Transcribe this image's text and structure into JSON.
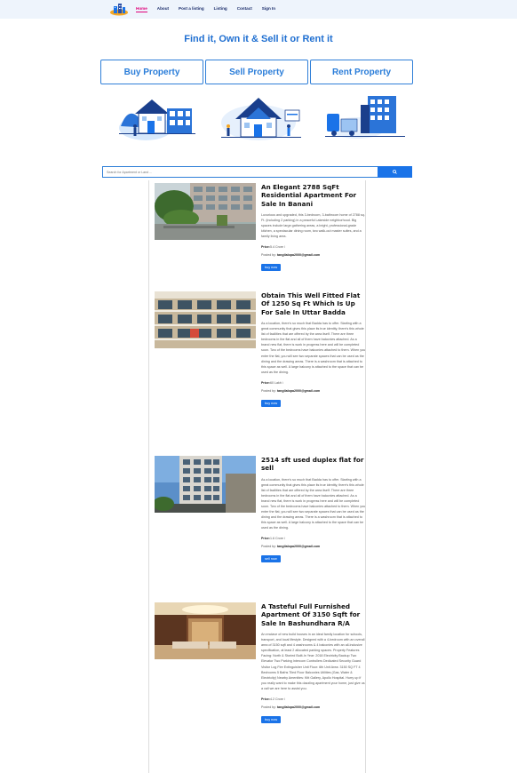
{
  "nav": {
    "items": [
      {
        "label": "Home",
        "active": true
      },
      {
        "label": "About"
      },
      {
        "label": "Post a listing"
      },
      {
        "label": "Listing"
      },
      {
        "label": "Contact"
      },
      {
        "label": "Sign In"
      }
    ]
  },
  "hero": {
    "title": "Find it, Own it & Sell it or Rent it",
    "tabs": [
      "Buy Property",
      "Sell Property",
      "Rent Property"
    ]
  },
  "search": {
    "placeholder": "Search for Apartment or Land ...",
    "button_icon": "search-icon"
  },
  "listings": [
    {
      "title": "An Elegant 2788 SqFt Residential Apartment For Sale In Banani",
      "description": "Luxurious and upgraded, this 3-bedroom, 3-bathroom home of 2788 sq. Ft. (including 2 parking) in a peaceful Lakeside neighborhood. Big spaces include large gathering areas, a bright, professional-grade kitchen, a spectacular dining room, two walk-out master suites, and a family living area.",
      "price_label": "Price:",
      "price": "5.4 Crore \\",
      "posted_label": "Posted by: ",
      "posted_by": "tangilalopa2000@gmail.com",
      "button": "buy now"
    },
    {
      "title": "Obtain This Well Fitted Flat Of 1250 Sq Ft Which Is Up For Sale In Uttar Badda",
      "description": "As a location, there's so much that Badda has to offer. Starting with a great community that gives this place its true identity, there's this whole list of facilities that are offered by the area itself. There are three bedrooms in the flat and all of them have balconies attached. As a brand new flat, there is work in progress here and will be completed soon. Two of the bedrooms have balconies attached to them. When you enter the flat, you will see two separate spaces that can be used as the dining and the drawing areas. There is a washroom that is attached to this space as well. A large balcony is attached to the space that can be used as the dining.",
      "price_label": "Price:",
      "price": "60 Lakh \\",
      "posted_label": "Posted by: ",
      "posted_by": "tangilalopa2000@gmail.com",
      "button": "buy now"
    },
    {
      "title": "2514 sft used duplex flat for sell",
      "description": "As a location, there's so much that Badda has to offer. Starting with a great community that gives this place its true identity, there's this whole list of facilities that are offered by the area itself. There are three bedrooms in the flat and all of them have balconies attached. As a brand new flat, there is work in progress here and will be completed soon. Two of the bedrooms have balconies attached to them. When you enter the flat, you will see two separate spaces that can be used as the dining and the drawing areas. There is a washroom that is attached to this space as well. A large balcony is attached to the space that can be used as the dining.",
      "price_label": "Price:",
      "price": "1.6 Crore \\",
      "posted_label": "Posted by: ",
      "posted_by": "tangilalopa2000@gmail.com",
      "button": "sell now"
    },
    {
      "title": "A Tasteful Full Furnished Apartment Of 3150 Sqft for Sale In Bashundhara R/A",
      "description": "An enclave of new build houses in an ideal family location for schools, transport, and local lifestyle. Designed with a 4-bedroom with an overall area of 3150 sqft and 4 washrooms & 4 balconies with an all-inclusive specification, at least 2 allocated parking spaces. Property Features Facing: North & Storied Built-In Year: 2018 Electricity Backup Two Elevator Two Parking Intercom Controllers Dedicated Security Guard Visitor Log Fire Extinguisher Unit Floor: 6th Unit Area: 3150 SQ FT 4 Bedrooms 5 Baths Tiled Floor Balconies Utilities (Gas, Water & Electricity) Nearby Amenities: Kitt Gallery, Apollo Hospital. Hurry up if you really want to make this dazzling apartment your home, just give us a call we are here to assist you.",
      "price_label": "Price:",
      "price": "4.2 Crore \\",
      "posted_label": "Posted by: ",
      "posted_by": "tangilalopa2000@gmail.com",
      "button": "buy now"
    }
  ],
  "colors": {
    "accent": "#1a73e8",
    "nav_active": "#e0007a",
    "hero_title": "#1f6fd1",
    "navbar_bg": "#eef4fc"
  }
}
